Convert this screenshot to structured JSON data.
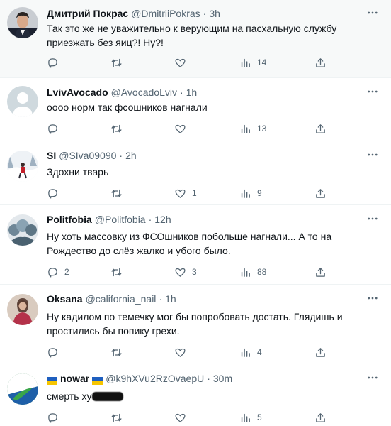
{
  "tweets": [
    {
      "name": "Дмитрий Покрас",
      "handle": "@DmitriiPokras",
      "dot": "·",
      "time": "3h",
      "text": "Так это же не уважительно к верующим на пасхальную службу приезжать без яиц?! Ну?!",
      "replies": "",
      "retweets": "",
      "likes": "",
      "views": "14"
    },
    {
      "name": "LvivAvocado",
      "handle": "@AvocadoLviv",
      "dot": "·",
      "time": "1h",
      "text": "оооо норм так фсошников нагнали",
      "replies": "",
      "retweets": "",
      "likes": "",
      "views": "13"
    },
    {
      "name": "SI",
      "handle": "@SIva09090",
      "dot": "·",
      "time": "2h",
      "text": "Здохни тварь",
      "replies": "",
      "retweets": "",
      "likes": "1",
      "views": "9"
    },
    {
      "name": "Politfobia",
      "handle": "@Politfobia",
      "dot": "·",
      "time": "12h",
      "text": "Ну хоть массовку из ФСОшников побольше нагнали... А то на Рождество до слёз жалко и убого было.",
      "replies": "2",
      "retweets": "",
      "likes": "3",
      "views": "88"
    },
    {
      "name": "Oksana",
      "handle": "@california_nail",
      "dot": "·",
      "time": "1h",
      "text": "Ну кадилом по темечку мог бы попробовать достать. Глядишь и простились бы  попику грехи.",
      "replies": "",
      "retweets": "",
      "likes": "",
      "views": "4"
    },
    {
      "name": "nowar",
      "handle": "@k9hXVu2RzOvaepU",
      "dot": "·",
      "time": "30m",
      "text": "смерть ху",
      "replies": "",
      "retweets": "",
      "likes": "",
      "views": "5"
    }
  ],
  "colors": {
    "text": "#0f1419",
    "secondary": "#536471",
    "divider": "#eff3f4",
    "highlight_bg": "#f7f9f9"
  },
  "icons": [
    "reply-icon",
    "retweet-icon",
    "like-icon",
    "views-icon",
    "share-icon",
    "more-icon"
  ]
}
